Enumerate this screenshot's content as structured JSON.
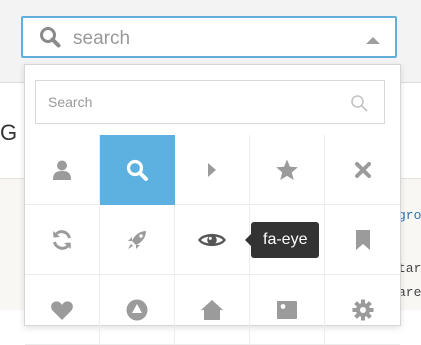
{
  "page": {
    "heading_char": "G",
    "bg_text_lines": [
      "gro",
      "tar",
      "are"
    ]
  },
  "picker": {
    "placeholder": "search",
    "search_placeholder": "Search",
    "accent_color": "#5cb1e1",
    "icon_color": "#9b9b9b"
  },
  "tooltip": {
    "text": "fa-eye"
  },
  "icons": [
    {
      "name": "user",
      "selected": false
    },
    {
      "name": "search",
      "selected": true
    },
    {
      "name": "caret-right",
      "selected": false
    },
    {
      "name": "star",
      "selected": false
    },
    {
      "name": "times",
      "selected": false
    },
    {
      "name": "refresh",
      "selected": false
    },
    {
      "name": "rocket",
      "selected": false
    },
    {
      "name": "eye",
      "selected": false
    },
    {
      "name": "empty",
      "selected": false
    },
    {
      "name": "bookmark",
      "selected": false
    },
    {
      "name": "heart",
      "selected": false
    },
    {
      "name": "warning",
      "selected": false
    },
    {
      "name": "home",
      "selected": false
    },
    {
      "name": "picture",
      "selected": false
    },
    {
      "name": "cog",
      "selected": false
    }
  ]
}
